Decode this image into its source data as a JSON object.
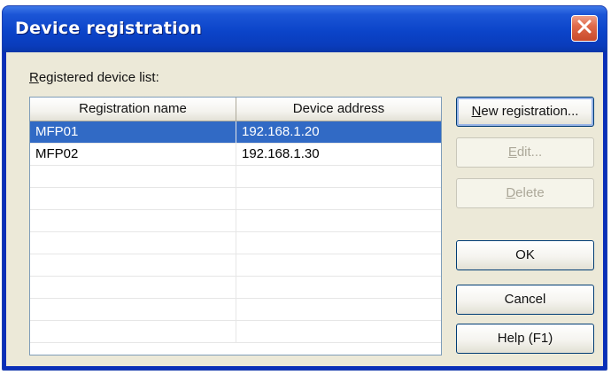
{
  "window": {
    "title": "Device registration"
  },
  "list": {
    "label_prefix": "R",
    "label_rest": "egistered device list:",
    "columns": [
      "Registration name",
      "Device address"
    ],
    "rows": [
      {
        "name": "MFP01",
        "address": "192.168.1.20",
        "selected": true
      },
      {
        "name": "MFP02",
        "address": "192.168.1.30",
        "selected": false
      }
    ]
  },
  "buttons": {
    "new_prefix": "N",
    "new_rest": "ew registration...",
    "edit_prefix": "E",
    "edit_rest": "dit...",
    "delete_prefix": "D",
    "delete_rest": "elete",
    "ok": "OK",
    "cancel": "Cancel",
    "help": "Help (F1)"
  },
  "icons": {
    "close": "close-icon"
  },
  "colors": {
    "title_bar": "#0b44c9",
    "selection": "#316ac5",
    "dialog_face": "#ece9d8",
    "close_button": "#e06a4a"
  }
}
